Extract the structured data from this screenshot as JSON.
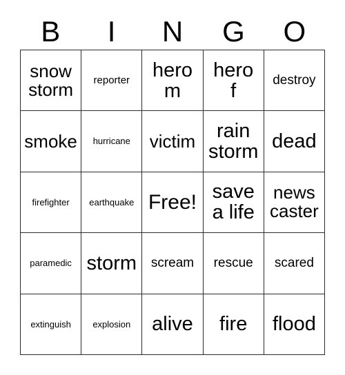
{
  "card": {
    "header_letters": [
      "B",
      "I",
      "N",
      "G",
      "O"
    ],
    "free_space_label": "Free!",
    "rows": [
      [
        {
          "text": "snow\nstorm",
          "size": "xl"
        },
        {
          "text": "reporter",
          "size": "s"
        },
        {
          "text": "hero\nm",
          "size": "xxl"
        },
        {
          "text": "hero\nf",
          "size": "xxl"
        },
        {
          "text": "destroy",
          "size": "m"
        }
      ],
      [
        {
          "text": "smoke",
          "size": "xl"
        },
        {
          "text": "hurricane",
          "size": "xs"
        },
        {
          "text": "victim",
          "size": "xl"
        },
        {
          "text": "rain\nstorm",
          "size": "xxl"
        },
        {
          "text": "dead",
          "size": "xxl"
        }
      ],
      [
        {
          "text": "firefighter",
          "size": "xs"
        },
        {
          "text": "earthquake",
          "size": "xs"
        },
        {
          "text": "Free!",
          "size": "free"
        },
        {
          "text": "save\na life",
          "size": "xxl"
        },
        {
          "text": "news\ncaster",
          "size": "xl"
        }
      ],
      [
        {
          "text": "paramedic",
          "size": "xs"
        },
        {
          "text": "storm",
          "size": "xxl"
        },
        {
          "text": "scream",
          "size": "m"
        },
        {
          "text": "rescue",
          "size": "m"
        },
        {
          "text": "scared",
          "size": "m"
        }
      ],
      [
        {
          "text": "extinguish",
          "size": "xs"
        },
        {
          "text": "explosion",
          "size": "xs"
        },
        {
          "text": "alive",
          "size": "xxl"
        },
        {
          "text": "fire",
          "size": "xxl"
        },
        {
          "text": "flood",
          "size": "xxl"
        }
      ]
    ]
  },
  "colors": {
    "background": "#ffffff",
    "text": "#000000",
    "grid_line": "#2b2b2b"
  }
}
